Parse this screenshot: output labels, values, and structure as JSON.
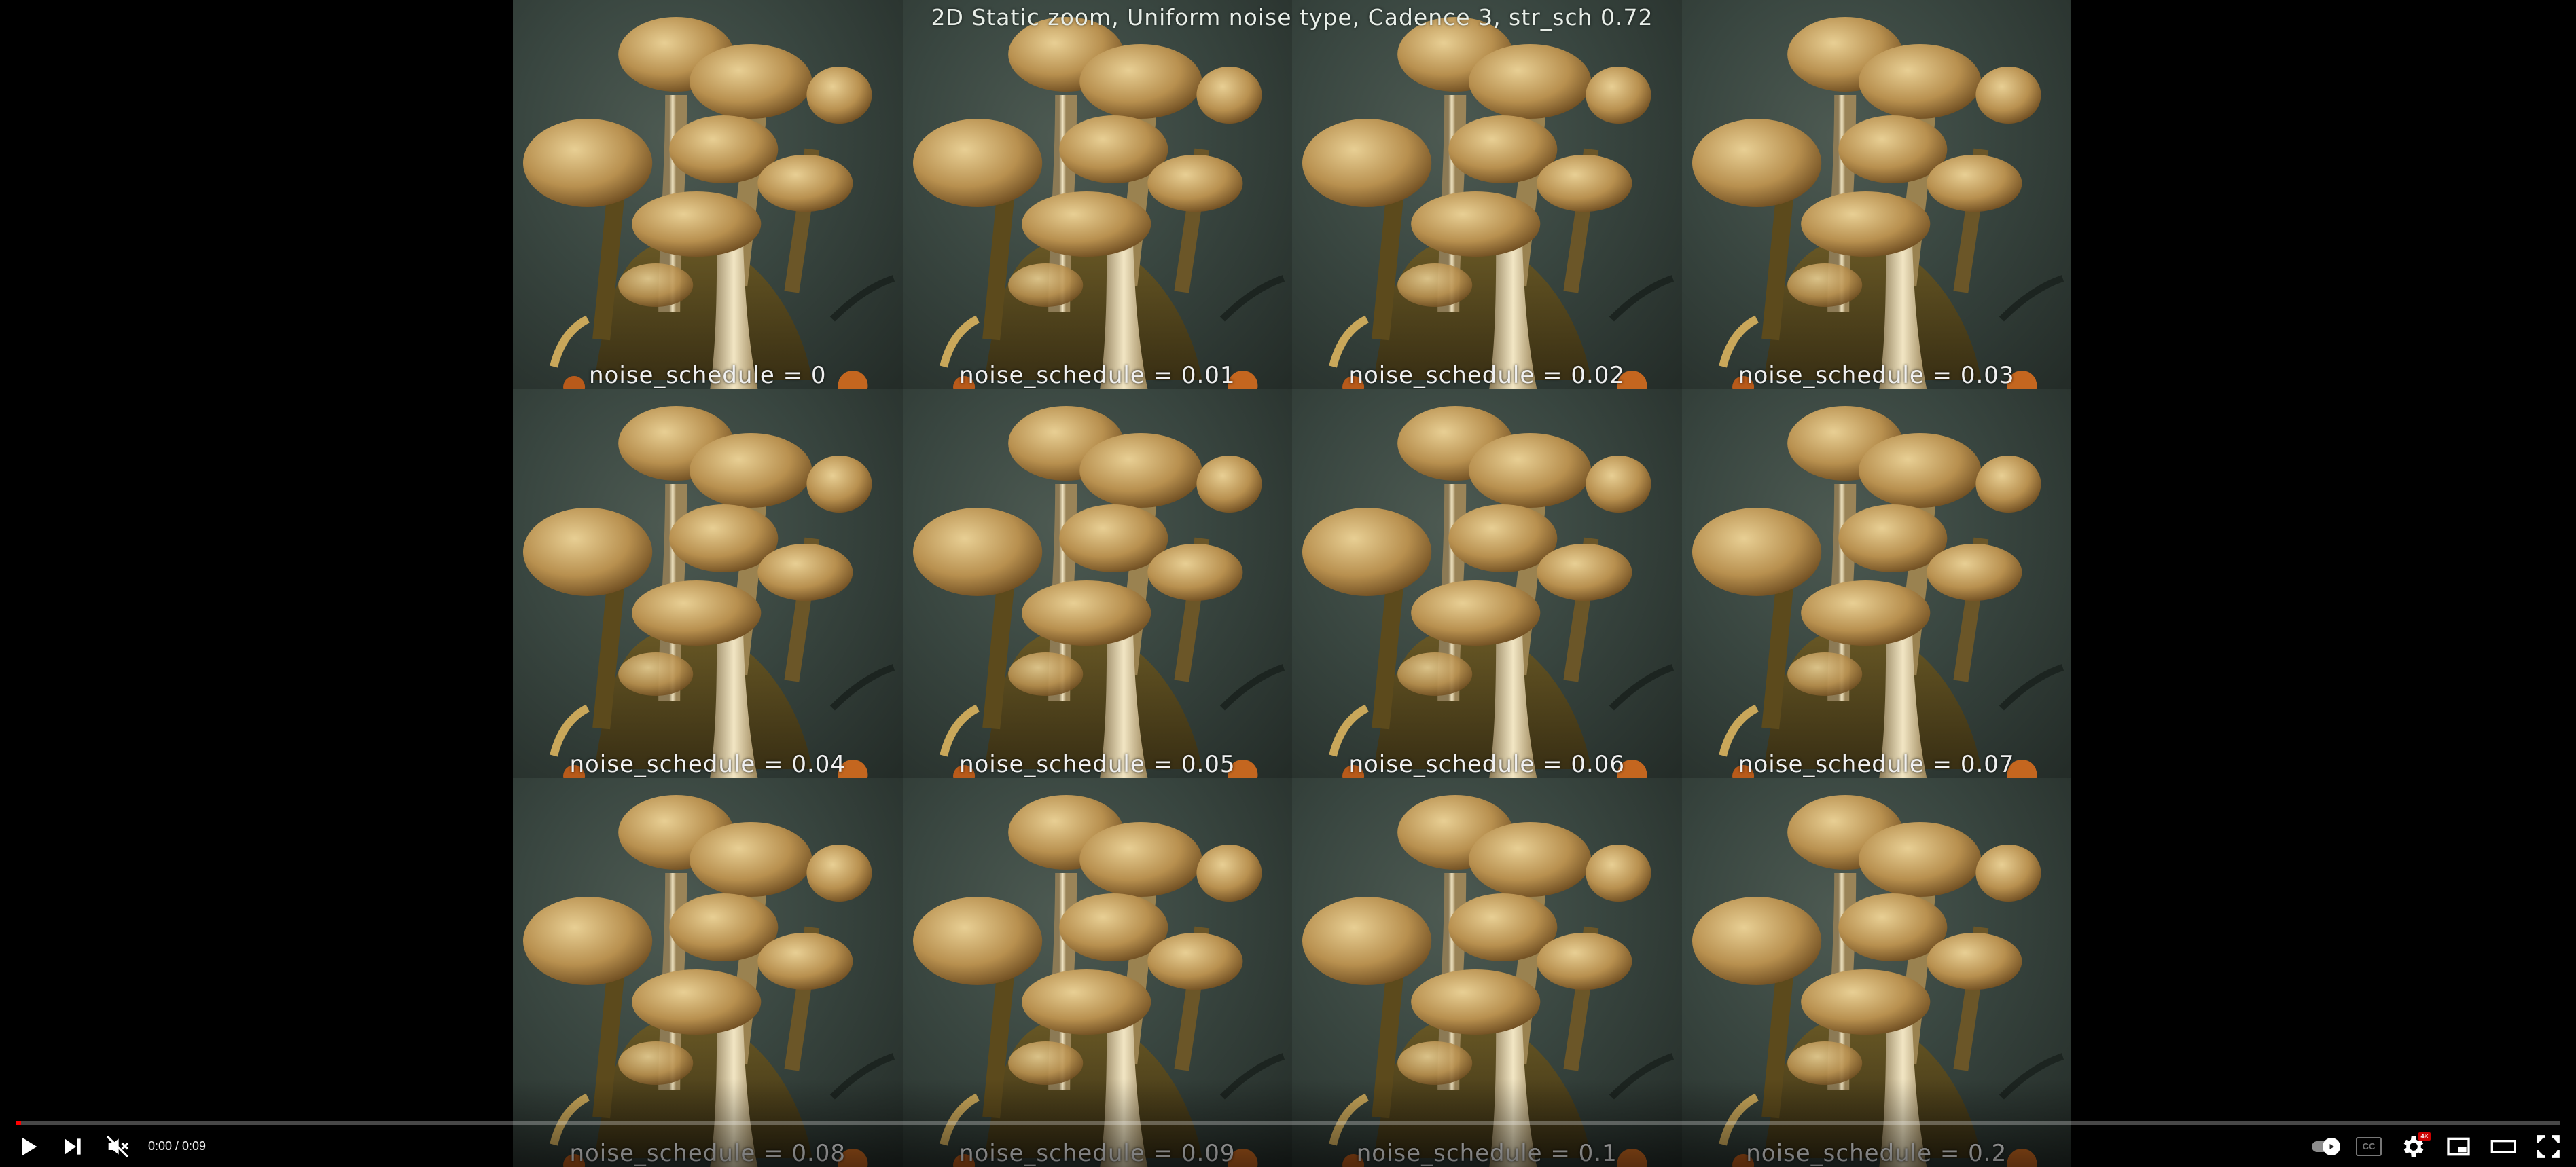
{
  "video": {
    "title": "2D Static zoom, Uniform noise type, Cadence 3, str_sch 0.72",
    "tiles": [
      {
        "label": "noise_schedule = 0"
      },
      {
        "label": "noise_schedule = 0.01"
      },
      {
        "label": "noise_schedule = 0.02"
      },
      {
        "label": "noise_schedule = 0.03"
      },
      {
        "label": "noise_schedule = 0.04"
      },
      {
        "label": "noise_schedule = 0.05"
      },
      {
        "label": "noise_schedule = 0.06"
      },
      {
        "label": "noise_schedule = 0.07"
      },
      {
        "label": "noise_schedule = 0.08"
      },
      {
        "label": "noise_schedule = 0.09"
      },
      {
        "label": "noise_schedule = 0.1"
      },
      {
        "label": "noise_schedule = 0.2"
      }
    ]
  },
  "controls": {
    "time_display": "0:00 / 0:09",
    "progress_fraction": 0.002,
    "cc_label": "CC",
    "quality_badge": "4K",
    "icons": {
      "play": "play-icon",
      "next": "next-icon",
      "mute": "volume-muted-icon",
      "autoplay": "autoplay-toggle-icon",
      "settings": "gear-icon",
      "miniplayer": "miniplayer-icon",
      "theater": "theater-mode-icon",
      "fullscreen": "fullscreen-icon"
    },
    "colors": {
      "progress": "#ff0000",
      "badge": "#cc0000"
    }
  }
}
